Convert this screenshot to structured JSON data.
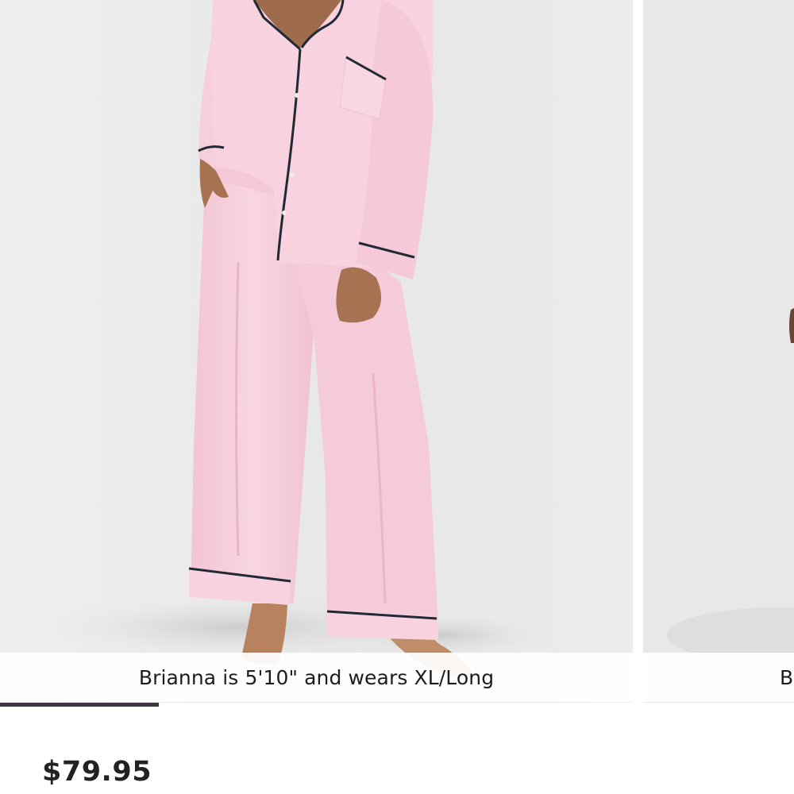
{
  "gallery": {
    "slides": [
      {
        "image_name": "pink-pajama-set-photo",
        "caption": "Brianna is 5'10\" and wears XL/Long"
      },
      {
        "image_name": "pink-pajama-set-photo-2",
        "caption": "B"
      }
    ],
    "progress": {
      "current": 1,
      "fraction": 0.2
    }
  },
  "product": {
    "price": "$79.95"
  },
  "colors": {
    "fabric": "#f7cfdc",
    "piping": "#1f2a35",
    "background": "#e9e9ea",
    "progress": "#3e3343"
  }
}
